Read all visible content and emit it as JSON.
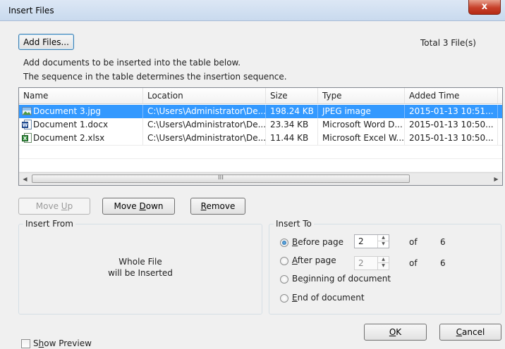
{
  "window": {
    "title": "Insert Files",
    "close_label": "x"
  },
  "toolbar": {
    "add_files_label": "Add Files...",
    "total_files": "Total 3 File(s)"
  },
  "instructions": [
    "Add documents to be inserted into the table below.",
    "The sequence in the table determines the insertion sequence."
  ],
  "table": {
    "columns": [
      "Name",
      "Location",
      "Size",
      "Type",
      "Added Time"
    ],
    "rows": [
      {
        "icon": "jpg-file-icon",
        "name": "Document 3.jpg",
        "location": "C:\\Users\\Administrator\\De...",
        "size": "198.24 KB",
        "type": "JPEG image",
        "added": "2015-01-13 10:51...",
        "selected": true
      },
      {
        "icon": "word-file-icon",
        "name": "Document 1.docx",
        "location": "C:\\Users\\Administrator\\De...",
        "size": "23.34 KB",
        "type": "Microsoft Word D...",
        "added": "2015-01-13 10:50...",
        "selected": false
      },
      {
        "icon": "excel-file-icon",
        "name": "Document 2.xlsx",
        "location": "C:\\Users\\Administrator\\De...",
        "size": "11.44 KB",
        "type": "Microsoft Excel W...",
        "added": "2015-01-13 10:50...",
        "selected": false
      }
    ],
    "scroll_thumb_label": "III"
  },
  "actions": {
    "move_up_label": "Move ",
    "move_up_key": "U",
    "move_up_rest": "p",
    "move_down_label": "Move ",
    "move_down_key": "D",
    "move_down_rest": "own",
    "remove_key": "R",
    "remove_rest": "emove"
  },
  "insert_from": {
    "legend": "Insert From",
    "line1": "Whole File",
    "line2": "will be Inserted"
  },
  "insert_to": {
    "legend": "Insert To",
    "before_key": "B",
    "before_rest": "efore page",
    "before_value": "2",
    "after_key": "A",
    "after_rest": "fter page",
    "after_value": "2",
    "of_label": "of",
    "total_pages": "6",
    "beginning_pre": "Be",
    "beginning_key": "g",
    "beginning_rest": "inning of document",
    "end_key": "E",
    "end_rest": "nd of document",
    "selected": "before"
  },
  "footer": {
    "ok_key": "O",
    "ok_rest": "K",
    "cancel_pre": "",
    "cancel_key": "C",
    "cancel_rest": "ancel",
    "show_preview_pre": "S",
    "show_preview_key": "h",
    "show_preview_rest": "ow Preview"
  }
}
